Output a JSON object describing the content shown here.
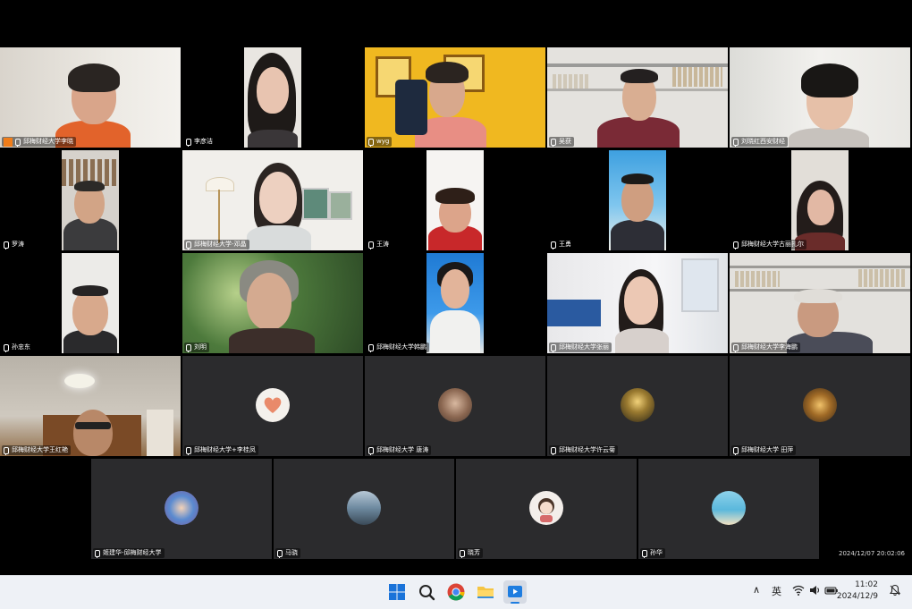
{
  "participants": [
    {
      "name": "邱梅财经大学李晓"
    },
    {
      "name": "李彦洁"
    },
    {
      "name": "wyg"
    },
    {
      "name": "吴获"
    },
    {
      "name": "刘晓红西安财经"
    },
    {
      "name": "罗涛"
    },
    {
      "name": "邱梅财经大学-邓晶"
    },
    {
      "name": "王涛"
    },
    {
      "name": "王勇"
    },
    {
      "name": "邱梅财经大学古丽扎尔"
    },
    {
      "name": "孙忠东"
    },
    {
      "name": "刘明"
    },
    {
      "name": "邱梅财经大学韩鹏"
    },
    {
      "name": "邱梅财经大学张丽"
    },
    {
      "name": "邱梅财经大学李海鹏"
    },
    {
      "name": "邱梅财经大学王红艳"
    },
    {
      "name": "邱梅财经大学+李桂凤"
    },
    {
      "name": "邱梅财经大学 唐涛"
    },
    {
      "name": "邱梅财经大学许云菊"
    },
    {
      "name": "邱梅财经大学 田萍"
    },
    {
      "name": "姬建华-邱梅财经大学"
    },
    {
      "name": "马骁"
    },
    {
      "name": "晓芳"
    },
    {
      "name": "孙华"
    }
  ],
  "meeting_timestamp": "2024/12/07 20:02:06",
  "taskbar": {
    "apps": [
      "windows-start",
      "search",
      "chrome",
      "file-explorer",
      "meeting-app"
    ],
    "input_indicator": "英",
    "clock_time": "11:02",
    "clock_date": "2024/12/9"
  },
  "colors": {
    "screen_bg": "#000000",
    "camera_off_tile": "#2b2b2d",
    "active_speaker_border": "#2ea043",
    "speaking_badge": "#f07d1a",
    "taskbar_bg": "#eef1f6"
  }
}
